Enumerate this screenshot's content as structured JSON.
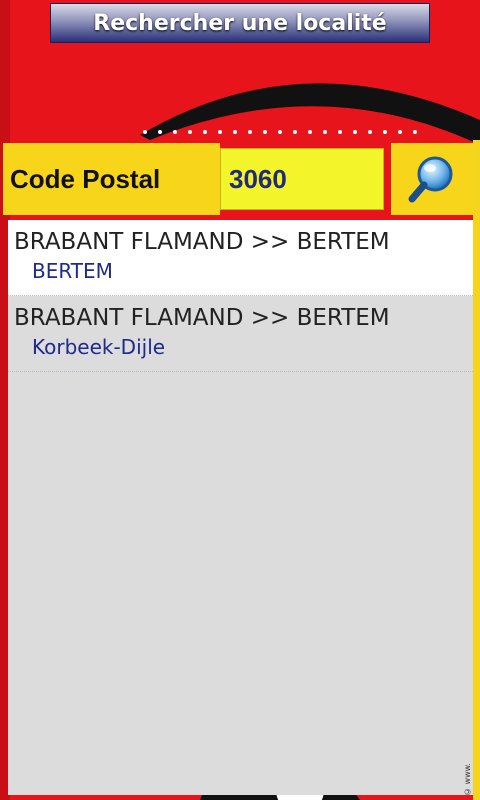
{
  "window": {
    "title": "Rechercher une localité"
  },
  "search": {
    "label": "Code Postal",
    "value": "3060",
    "button_icon": "search-icon"
  },
  "results": [
    {
      "region": "BRABANT FLAMAND >> BERTEM",
      "locality": "BERTEM",
      "selected": true
    },
    {
      "region": "BRABANT FLAMAND >> BERTEM",
      "locality": "Korbeek-Dijle",
      "selected": false
    }
  ],
  "footer": {
    "copyright": "© www."
  },
  "colors": {
    "background": "#e8141c",
    "accent_yellow": "#f7d51a",
    "input_yellow": "#f4f42a",
    "link_blue": "#1e2a8c"
  }
}
